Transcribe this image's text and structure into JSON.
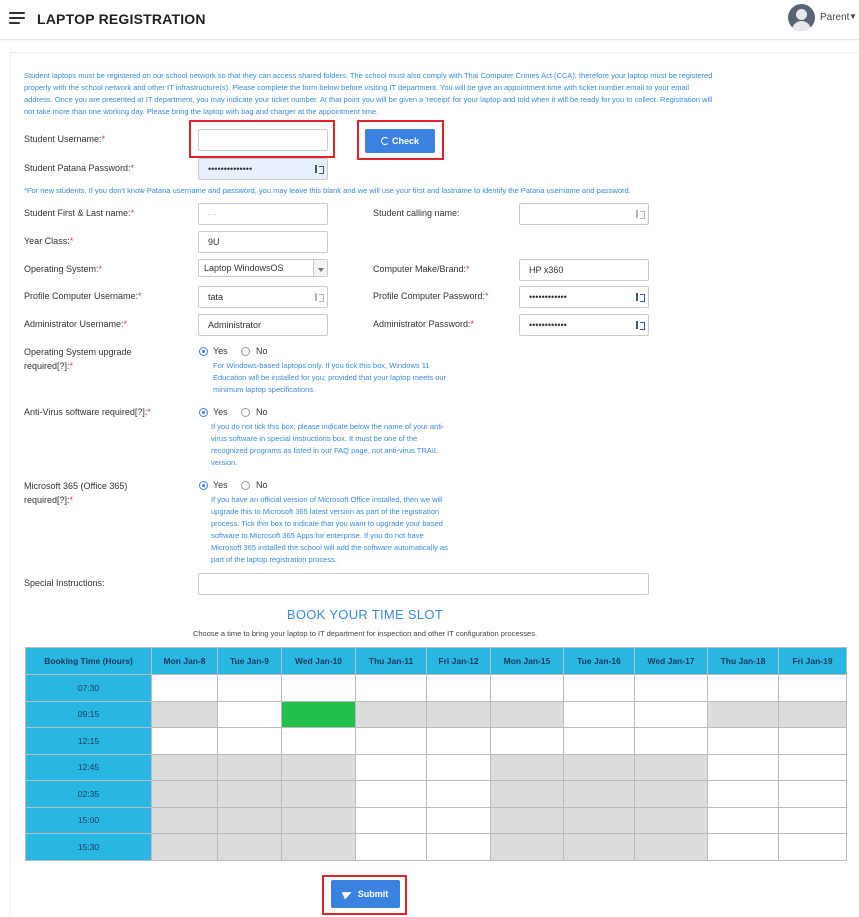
{
  "header": {
    "title": "LAPTOP REGISTRATION",
    "user": "Parent"
  },
  "intro": "Student laptops must be registered on our school network so that they can access shared folders. The school must also comply with Thai Computer Crimes Act (CCA); therefore your laptop must be registered properly with the school network and other IT infrastructure(s). Please complete the form below before visiting IT department. You will be give an appointment time with ticket number email to your email address. Once you are presented at IT department, you may indicate your ticket number. At that point you will be given a 'receipt' for your laptop and told when it will be ready for you to collect. Registration will not take more than one working day. Please bring the laptop with bag and charger at the appointment time.",
  "note": "*For new students, If you don't know Patana username and password, you may leave this blank and we will use your first and lastname to identify the Patana username and password.",
  "required_mark": "*",
  "form": {
    "student_username": {
      "label": "Student Username:",
      "value": ""
    },
    "check_button": "Check",
    "patana_password": {
      "label": "Student Patana Password:",
      "value": "••••••••••••••"
    },
    "first_last_name": {
      "label": "Student First & Last name:",
      "value": "·      ·"
    },
    "calling_name": {
      "label": "Student calling name:",
      "value": ""
    },
    "year_class": {
      "label": "Year Class:",
      "value": "9U"
    },
    "operating_system": {
      "label": "Operating System:",
      "value": "Laptop WindowsOS"
    },
    "computer_brand": {
      "label": "Computer Make/Brand:",
      "value": "HP x360"
    },
    "profile_username": {
      "label": "Profile Computer Username:",
      "value": "tata"
    },
    "profile_password": {
      "label": "Profile Computer Password:",
      "value": "••••••••••••"
    },
    "admin_username": {
      "label": "Administrator Username:",
      "value": "Administrator"
    },
    "admin_password": {
      "label": "Administrator Password:",
      "value": "••••••••••••"
    },
    "os_upgrade": {
      "label_line1": "Operating System upgrade",
      "label_line2": "required[?]:",
      "yes": "Yes",
      "no": "No",
      "selected": "Yes",
      "help": [
        "For Windows-based laptops only. If you tick this box, Windows 11",
        "Education will be installed for you; provided that your laptop meets our",
        "minimum laptop specifications."
      ]
    },
    "antivirus": {
      "label": "Anti-Virus software required[?]:",
      "yes": "Yes",
      "no": "No",
      "selected": "Yes",
      "help": [
        "If you do not tick this box, please indicate below the name of your anti-",
        "virus software in special instructions box. It must be one of the",
        "recognized programs as listed in our FAQ page, not anti-virus TRAIL",
        "version."
      ]
    },
    "ms365": {
      "label_line1": "Microsoft 365 (Office 365)",
      "label_line2": "required[?]:",
      "yes": "Yes",
      "no": "No",
      "selected": "Yes",
      "help": [
        "If you have an official version of Microsoft Office installed, then we will",
        "upgrade this to Microsoft 365 latest version as part of the registration",
        "process. Tick this box to indicate that you want to upgrade your based",
        "software to Microsoft 365 Apps for enterprise. If you do not have",
        "Microsoft 365 installed the school will add the software automatically as",
        "part of the laptop registration process."
      ]
    },
    "special_instructions": {
      "label": "Special Instructions:",
      "value": ""
    }
  },
  "booking": {
    "title": "BOOK YOUR TIME SLOT",
    "subtitle": "Choose a time to bring your laptop to IT department for inspection and other IT configuration processes.",
    "time_header": "Booking Time (Hours)",
    "days": [
      "Mon Jan-8",
      "Tue Jan-9",
      "Wed Jan-10",
      "Thu Jan-11",
      "Fri Jan-12",
      "Mon Jan-15",
      "Tue Jan-16",
      "Wed Jan-17",
      "Thu Jan-18",
      "Fri Jan-19"
    ],
    "rows": [
      {
        "time": "07:30",
        "cells": [
          "open",
          "open",
          "open",
          "open",
          "open",
          "open",
          "open",
          "open",
          "open",
          "open"
        ]
      },
      {
        "time": "09:15",
        "cells": [
          "unavailable",
          "open",
          "selected",
          "unavailable",
          "unavailable",
          "unavailable",
          "open",
          "open",
          "unavailable",
          "unavailable"
        ]
      },
      {
        "time": "12:15",
        "cells": [
          "open",
          "open",
          "open",
          "open",
          "open",
          "open",
          "open",
          "open",
          "open",
          "open"
        ]
      },
      {
        "time": "12:45",
        "cells": [
          "unavailable",
          "unavailable",
          "unavailable",
          "open",
          "open",
          "unavailable",
          "unavailable",
          "unavailable",
          "open",
          "open"
        ]
      },
      {
        "time": "02:35",
        "cells": [
          "unavailable",
          "unavailable",
          "unavailable",
          "open",
          "open",
          "unavailable",
          "unavailable",
          "unavailable",
          "open",
          "open"
        ]
      },
      {
        "time": "15:00",
        "cells": [
          "unavailable",
          "unavailable",
          "unavailable",
          "open",
          "open",
          "unavailable",
          "unavailable",
          "unavailable",
          "open",
          "open"
        ]
      },
      {
        "time": "15:30",
        "cells": [
          "unavailable",
          "unavailable",
          "unavailable",
          "open",
          "open",
          "unavailable",
          "unavailable",
          "unavailable",
          "open",
          "open"
        ]
      }
    ]
  },
  "submit_button": "Submit",
  "colors": {
    "accent": "#3b82e0",
    "header_cell": "#29b6e3",
    "selected_slot": "#22c04a",
    "unavailable_slot": "#dcdcdc",
    "highlight_box": "#e0232c",
    "info_text": "#3b8ad9"
  }
}
